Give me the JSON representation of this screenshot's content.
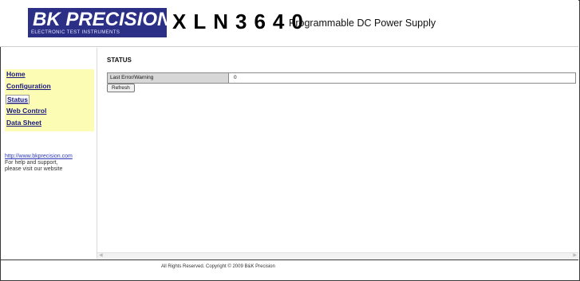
{
  "header": {
    "logo_text": "BK PRECISION",
    "logo_tagline": "ELECTRONIC TEST INSTRUMENTS",
    "model": "XLN3640",
    "product": "Programmable DC Power Supply",
    "brand_color": "#2b2f86"
  },
  "nav": {
    "items": [
      {
        "label": "Home"
      },
      {
        "label": "Configuration"
      },
      {
        "label": "Status"
      },
      {
        "label": "Web Control"
      },
      {
        "label": "Data Sheet"
      }
    ],
    "active": "Status",
    "background": "#fdfcb4"
  },
  "sidebar": {
    "link": "http://www.bkprecision.com",
    "help_line1": "For help and support,",
    "help_line2": "please visit our website"
  },
  "main": {
    "title": "STATUS",
    "row_label": "Last Error/Warning",
    "row_value": "0",
    "refresh_label": "Refresh"
  },
  "footer": {
    "text": "All Rights Reserved. Copyright © 2009 B&K Precision"
  }
}
